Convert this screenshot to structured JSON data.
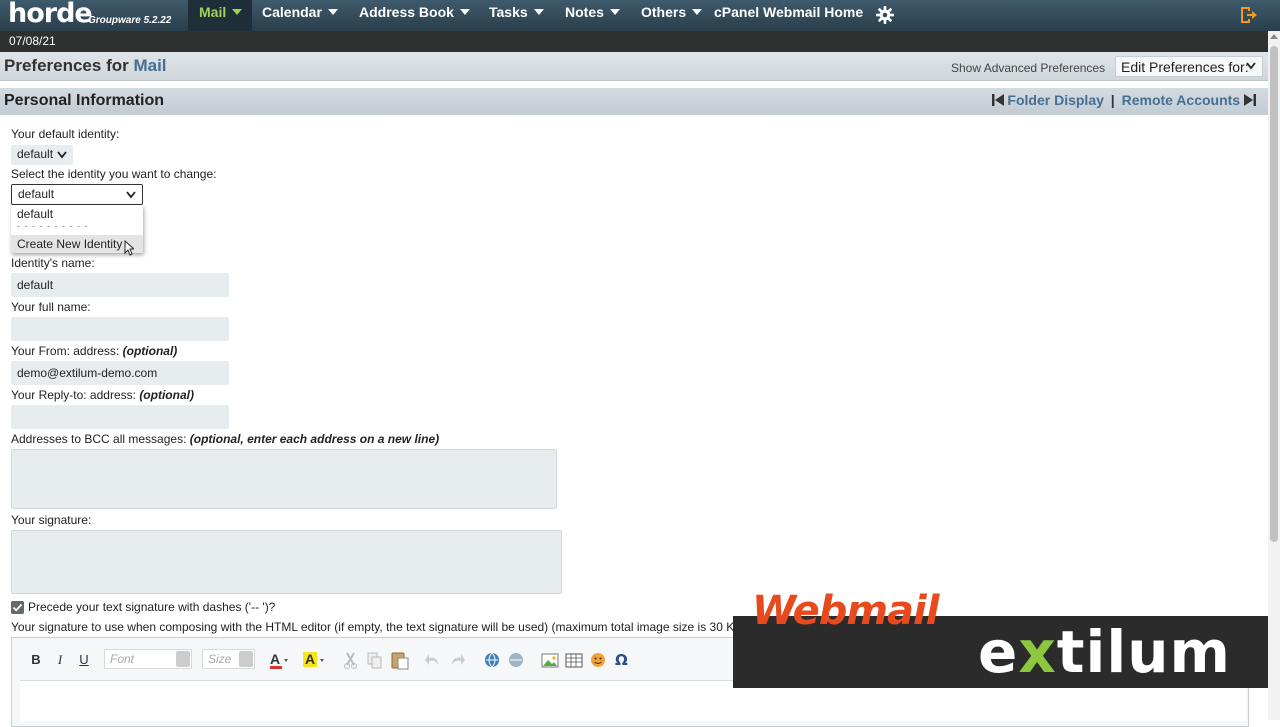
{
  "app": {
    "logo": "horde",
    "subtitle": "Groupware 5.2.22",
    "date": "07/08/21"
  },
  "nav": {
    "items": [
      {
        "label": "Mail",
        "active": true
      },
      {
        "label": "Calendar"
      },
      {
        "label": "Address Book"
      },
      {
        "label": "Tasks"
      },
      {
        "label": "Notes"
      },
      {
        "label": "Others"
      }
    ],
    "cpanel_label": "cPanel Webmail Home",
    "icons": {
      "settings": "gear-icon",
      "logout": "logout-icon"
    }
  },
  "prefs": {
    "title_prefix": "Preferences for",
    "title_app": "Mail",
    "advanced_link": "Show Advanced Preferences",
    "edit_for": "Edit Preferences for:"
  },
  "section": {
    "title": "Personal Information",
    "prev_link": "Folder Display",
    "separator": "|",
    "next_link": "Remote Accounts"
  },
  "form": {
    "default_identity_label": "Your default identity:",
    "default_identity_value": "default",
    "select_identity_label": "Select the identity you want to change:",
    "select_identity_value": "default",
    "dropdown_options": [
      "default",
      "- - - - - - - - - -",
      "Create New Identity"
    ],
    "identity_name_label": "Identity's name:",
    "identity_name_value": "default",
    "full_name_label": "Your full name:",
    "full_name_value": "",
    "from_label": "Your From: address:",
    "from_optional": "(optional)",
    "from_value": "demo@extilum-demo.com",
    "reply_label": "Your Reply-to: address:",
    "reply_optional": "(optional)",
    "reply_value": "",
    "bcc_label": "Addresses to BCC all messages:",
    "bcc_note": "(optional, enter each address on a new line)",
    "signature_label": "Your signature:",
    "dashes_label": "Precede your text signature with dashes ('-- ')?",
    "dashes_checked": true,
    "html_sig_label": "Your signature to use when composing with the HTML editor (if empty, the text signature will be used) (maximum total image size is 30 K"
  },
  "editor": {
    "bold": "B",
    "italic": "I",
    "underline": "U",
    "font_placeholder": "Font",
    "size_placeholder": "Size"
  },
  "branding": {
    "webmail": "Webmail",
    "extilum_prefix": "e",
    "extilum_x": "x",
    "extilum_suffix": "tilum",
    "colors": {
      "webmail": "#e8491d",
      "x": "#8dc63f"
    }
  }
}
